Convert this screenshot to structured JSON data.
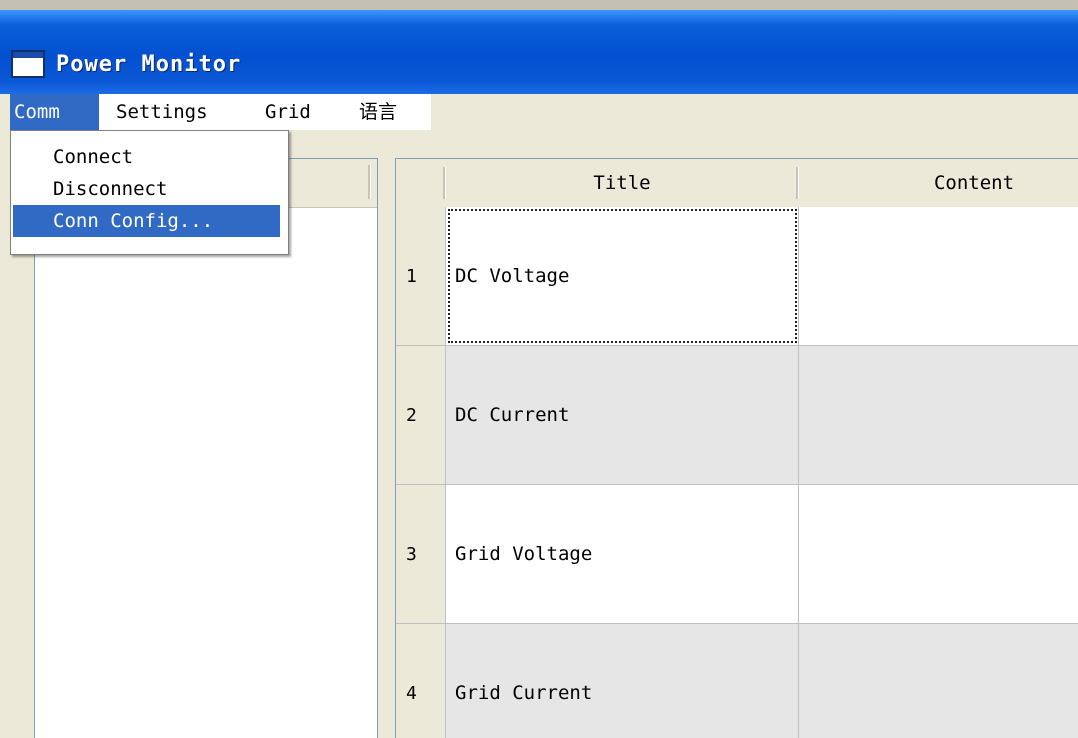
{
  "window": {
    "title": "Power Monitor"
  },
  "menu": {
    "items": [
      {
        "label": "Comm"
      },
      {
        "label": "Settings"
      },
      {
        "label": "Grid"
      },
      {
        "label": "语言"
      }
    ],
    "comm_dropdown": [
      {
        "label": "Connect"
      },
      {
        "label": "Disconnect"
      },
      {
        "label": "Conn Config..."
      }
    ]
  },
  "grid": {
    "columns": [
      "Title",
      "Content"
    ],
    "rows": [
      {
        "num": "1",
        "title": "DC Voltage",
        "content": ""
      },
      {
        "num": "2",
        "title": "DC Current",
        "content": ""
      },
      {
        "num": "3",
        "title": "Grid Voltage",
        "content": ""
      },
      {
        "num": "4",
        "title": "Grid Current",
        "content": ""
      }
    ]
  },
  "colors": {
    "title_bar": "#0350d0",
    "menu_highlight": "#316ac5",
    "window_bg": "#ece9d8",
    "alt_row": "#e6e6e6"
  }
}
